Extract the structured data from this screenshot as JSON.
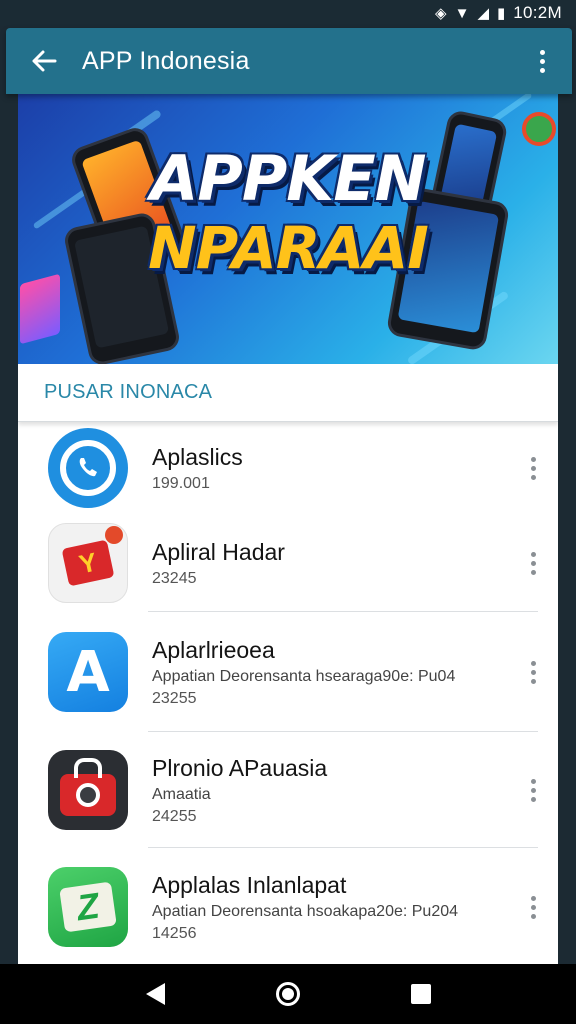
{
  "status_bar": {
    "time": "10:2M",
    "icons": [
      "signal-icon",
      "wifi-icon",
      "cell-icon",
      "battery-icon"
    ]
  },
  "app_bar": {
    "title": "APP Indonesia",
    "back_icon": "arrow-left-icon",
    "menu_icon": "more-vert-icon"
  },
  "banner": {
    "line1": "APPKEN",
    "line2": "NPARAAI"
  },
  "section": {
    "title": "PUSAR INONACA"
  },
  "apps": [
    {
      "name": "Aplaslics",
      "subtitle": "",
      "count": "199.001",
      "icon": "phone-icon",
      "color": "#1f8fe0"
    },
    {
      "name": "Apliral Hadar",
      "subtitle": "",
      "count": "23245",
      "icon": "wallet-icon",
      "color": "#e23a2c"
    },
    {
      "name": "Aplarlrieoea",
      "subtitle": "Appatian Deorensanta hsearaga90e: Pu04",
      "count": "23255",
      "icon": "letter-a-icon",
      "color": "#1e95f0"
    },
    {
      "name": "Plronio APauasia",
      "subtitle": "Amaatia",
      "count": "24255",
      "icon": "camera-bag-icon",
      "color": "#d92a2a"
    },
    {
      "name": "Applalas Inlanlapat",
      "subtitle": "Apatian Deorensanta hsoakapa20e: Pu204",
      "count": "14256",
      "icon": "letter-z-icon",
      "color": "#2fb54a"
    }
  ],
  "nav": {
    "back": "back-triangle-icon",
    "home": "home-circle-icon",
    "recents": "recents-square-icon"
  }
}
